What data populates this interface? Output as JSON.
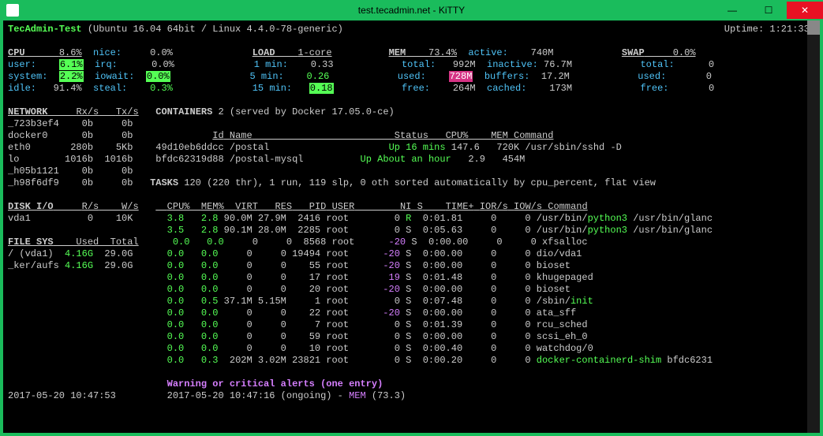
{
  "window": {
    "title": "test.tecadmin.net - KiTTY"
  },
  "header": {
    "hostname": "TecAdmin-Test",
    "os": "(Ubuntu 16.04 64bit / Linux 4.4.0-78-generic)",
    "uptime_label": "Uptime:",
    "uptime": "1:21:33"
  },
  "cpu": {
    "label": "CPU",
    "total": "8.6%",
    "nice_l": "nice:",
    "nice": "0.0%",
    "user_l": "user:",
    "user": "6.1%",
    "irq_l": "irq:",
    "irq": "0.0%",
    "system_l": "system:",
    "system": "2.2%",
    "iowait_l": "iowait:",
    "iowait": "0.0%",
    "idle_l": "idle:",
    "idle": "91.4%",
    "steal_l": "steal:",
    "steal": "0.3%"
  },
  "load": {
    "label": "LOAD",
    "cores": "1-core",
    "m1_l": "1 min:",
    "m1": "0.33",
    "m5_l": "5 min:",
    "m5": "0.26",
    "m15_l": "15 min:",
    "m15": "0.18"
  },
  "mem": {
    "label": "MEM",
    "pct": "73.4%",
    "active_l": "active:",
    "active": "740M",
    "total_l": "total:",
    "total": "992M",
    "inactive_l": "inactive:",
    "inactive": "76.7M",
    "used_l": "used:",
    "used": "728M",
    "buffers_l": "buffers:",
    "buffers": "17.2M",
    "free_l": "free:",
    "free": "264M",
    "cached_l": "cached:",
    "cached": "173M"
  },
  "swap": {
    "label": "SWAP",
    "pct": "0.0%",
    "total_l": "total:",
    "total": "0",
    "used_l": "used:",
    "used": "0",
    "free_l": "free:",
    "free": "0"
  },
  "network": {
    "label": "NETWORK",
    "h1": "Rx/s",
    "h2": "Tx/s",
    "rows": [
      {
        "n": "_723b3ef4",
        "rx": "0b",
        "tx": "0b"
      },
      {
        "n": "docker0",
        "rx": "0b",
        "tx": "0b"
      },
      {
        "n": "eth0",
        "rx": "280b",
        "tx": "5Kb"
      },
      {
        "n": "lo",
        "rx": "1016b",
        "tx": "1016b"
      },
      {
        "n": "_h05b1121",
        "rx": "0b",
        "tx": "0b"
      },
      {
        "n": "_h98f6df9",
        "rx": "0b",
        "tx": "0b"
      }
    ]
  },
  "containers": {
    "label": "CONTAINERS",
    "count": "2",
    "info": "(served by Docker 17.05.0-ce)",
    "hdr": {
      "id": "Id",
      "name": "Name",
      "status": "Status",
      "cpu": "CPU%",
      "mem": "MEM",
      "cmd": "Command"
    },
    "rows": [
      {
        "id": "49d10eb6ddcc",
        "name": "/postal",
        "status": "Up 16 mins",
        "cpu": "147.6",
        "mem": "720K",
        "cmd": "/usr/sbin/sshd -D"
      },
      {
        "id": "bfdc62319d88",
        "name": "/postal-mysql",
        "status": "Up About an hour",
        "cpu": "2.9",
        "mem": "454M",
        "cmd": ""
      }
    ]
  },
  "tasks": {
    "label": "TASKS",
    "text": "120 (220 thr), 1 run, 119 slp, 0 oth sorted automatically by cpu_percent, flat view"
  },
  "diskio": {
    "label": "DISK I/O",
    "h1": "R/s",
    "h2": "W/s",
    "rows": [
      {
        "n": "vda1",
        "r": "0",
        "w": "10K"
      }
    ]
  },
  "filesys": {
    "label": "FILE SYS",
    "h1": "Used",
    "h2": "Total",
    "rows": [
      {
        "n": "/ (vda1)",
        "u": "4.16G",
        "t": "29.0G"
      },
      {
        "n": "_ker/aufs",
        "u": "4.16G",
        "t": "29.0G"
      }
    ]
  },
  "proc": {
    "hdr": {
      "cpu": "CPU%",
      "mem": "MEM%",
      "virt": "VIRT",
      "res": "RES",
      "pid": "PID",
      "user": "USER",
      "ni": "NI",
      "s": "S",
      "time": "TIME+",
      "ior": "IOR/s",
      "iow": "IOW/s",
      "cmd": "Command"
    },
    "rows": [
      {
        "cpu": "3.8",
        "mem": "2.8",
        "virt": "90.0M",
        "res": "27.9M",
        "pid": "2416",
        "user": "root",
        "ni": "0",
        "s": "R",
        "time": "0:01.81",
        "ior": "0",
        "iow": "0",
        "cmd": "/usr/bin/",
        "cmd_hl": "python3",
        "cmd2": " /usr/bin/glanc"
      },
      {
        "cpu": "3.5",
        "mem": "2.8",
        "virt": "90.1M",
        "res": "28.0M",
        "pid": "2285",
        "user": "root",
        "ni": "0",
        "s": "S",
        "time": "0:05.63",
        "ior": "0",
        "iow": "0",
        "cmd": "/usr/bin/",
        "cmd_hl": "python3",
        "cmd2": " /usr/bin/glanc"
      },
      {
        "cpu": "0.0",
        "mem": "0.0",
        "virt": "0",
        "res": "0",
        "pid": "8568",
        "user": "root",
        "ni": "-20",
        "s": "S",
        "time": "0:00.00",
        "ior": "0",
        "iow": "0",
        "cmd": "xfsalloc"
      },
      {
        "cpu": "0.0",
        "mem": "0.0",
        "virt": "0",
        "res": "0",
        "pid": "19494",
        "user": "root",
        "ni": "-20",
        "s": "S",
        "time": "0:00.00",
        "ior": "0",
        "iow": "0",
        "cmd": "dio/vda1"
      },
      {
        "cpu": "0.0",
        "mem": "0.0",
        "virt": "0",
        "res": "0",
        "pid": "55",
        "user": "root",
        "ni": "-20",
        "s": "S",
        "time": "0:00.00",
        "ior": "0",
        "iow": "0",
        "cmd": "bioset"
      },
      {
        "cpu": "0.0",
        "mem": "0.0",
        "virt": "0",
        "res": "0",
        "pid": "17",
        "user": "root",
        "ni": "19",
        "s": "S",
        "time": "0:01.48",
        "ior": "0",
        "iow": "0",
        "cmd": "khugepaged"
      },
      {
        "cpu": "0.0",
        "mem": "0.0",
        "virt": "0",
        "res": "0",
        "pid": "20",
        "user": "root",
        "ni": "-20",
        "s": "S",
        "time": "0:00.00",
        "ior": "0",
        "iow": "0",
        "cmd": "bioset"
      },
      {
        "cpu": "0.0",
        "mem": "0.5",
        "virt": "37.1M",
        "res": "5.15M",
        "pid": "1",
        "user": "root",
        "ni": "0",
        "s": "S",
        "time": "0:07.48",
        "ior": "0",
        "iow": "0",
        "cmd": "/sbin/",
        "cmd_hl": "init"
      },
      {
        "cpu": "0.0",
        "mem": "0.0",
        "virt": "0",
        "res": "0",
        "pid": "22",
        "user": "root",
        "ni": "-20",
        "s": "S",
        "time": "0:00.00",
        "ior": "0",
        "iow": "0",
        "cmd": "ata_sff"
      },
      {
        "cpu": "0.0",
        "mem": "0.0",
        "virt": "0",
        "res": "0",
        "pid": "7",
        "user": "root",
        "ni": "0",
        "s": "S",
        "time": "0:01.39",
        "ior": "0",
        "iow": "0",
        "cmd": "rcu_sched"
      },
      {
        "cpu": "0.0",
        "mem": "0.0",
        "virt": "0",
        "res": "0",
        "pid": "59",
        "user": "root",
        "ni": "0",
        "s": "S",
        "time": "0:00.00",
        "ior": "0",
        "iow": "0",
        "cmd": "scsi_eh_0"
      },
      {
        "cpu": "0.0",
        "mem": "0.0",
        "virt": "0",
        "res": "0",
        "pid": "10",
        "user": "root",
        "ni": "0",
        "s": "S",
        "time": "0:00.40",
        "ior": "0",
        "iow": "0",
        "cmd": "watchdog/0"
      },
      {
        "cpu": "0.0",
        "mem": "0.3",
        "virt": "202M",
        "res": "3.02M",
        "pid": "23821",
        "user": "root",
        "ni": "0",
        "s": "S",
        "time": "0:00.20",
        "ior": "0",
        "iow": "0",
        "cmd": "",
        "cmd_hl": "docker-containerd-shim",
        "cmd2": " bfdc6231"
      }
    ]
  },
  "alerts": {
    "title": "Warning or critical alerts (one entry)",
    "ts": "2017-05-20 10:47:53",
    "entry_ts": "2017-05-20 10:47:16 (ongoing) -",
    "entry_key": "MEM",
    "entry_val": "(73.3)"
  }
}
